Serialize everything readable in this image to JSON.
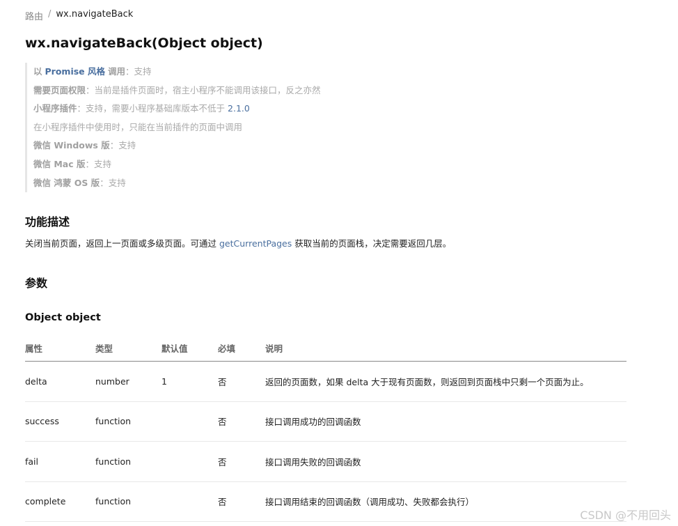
{
  "breadcrumb": {
    "parent": "路由",
    "separator": "/",
    "current": "wx.navigateBack"
  },
  "title": "wx.navigateBack(Object object)",
  "support": {
    "promise": {
      "prefix": "以",
      "link": "Promise 风格",
      "suffix": "调用",
      "value": "支持"
    },
    "permission": {
      "label": "需要页面权限",
      "value": "当前是插件页面时，宿主小程序不能调用该接口，反之亦然"
    },
    "plugin": {
      "label": "小程序插件",
      "value": "支持，需要小程序基础库版本不低于",
      "version": "2.1.0"
    },
    "plugin_note": "在小程序插件中使用时，只能在当前插件的页面中调用",
    "windows": {
      "label": "微信 Windows 版",
      "value": "支持"
    },
    "mac": {
      "label": "微信 Mac 版",
      "value": "支持"
    },
    "harmony": {
      "label": "微信 鸿蒙 OS 版",
      "value": "支持"
    },
    "colon": "："
  },
  "description": {
    "heading": "功能描述",
    "text_before": "关闭当前页面，返回上一页面或多级页面。可通过",
    "link": "getCurrentPages",
    "text_after": "获取当前的页面栈，决定需要返回几层。"
  },
  "params_heading": "参数",
  "object_heading": "Object object",
  "table": {
    "headers": [
      "属性",
      "类型",
      "默认值",
      "必填",
      "说明"
    ],
    "rows": [
      [
        "delta",
        "number",
        "1",
        "否",
        "返回的页面数，如果 delta 大于现有页面数，则返回到页面栈中只剩一个页面为止。"
      ],
      [
        "success",
        "function",
        "",
        "否",
        "接口调用成功的回调函数"
      ],
      [
        "fail",
        "function",
        "",
        "否",
        "接口调用失败的回调函数"
      ],
      [
        "complete",
        "function",
        "",
        "否",
        "接口调用结束的回调函数（调用成功、失败都会执行）"
      ]
    ]
  },
  "watermark": "CSDN @不用回头",
  "colors": {
    "link": "#4a6f9f",
    "muted": "#a9a9a9",
    "text": "#1f1f1f"
  }
}
